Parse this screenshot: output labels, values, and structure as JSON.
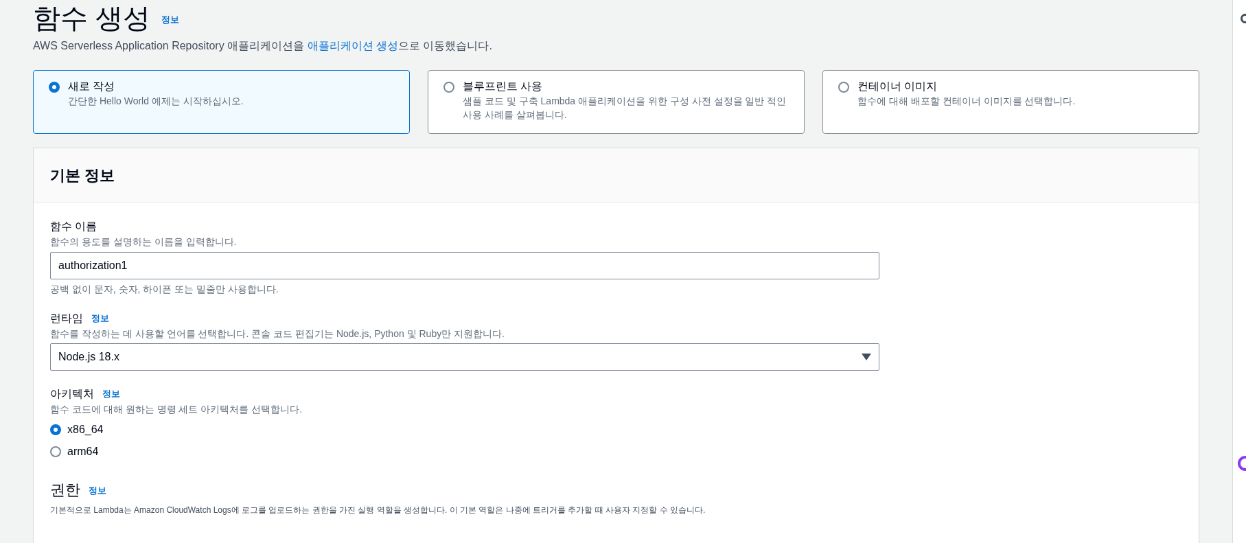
{
  "header": {
    "title": "함수 생성",
    "info_link": "정보",
    "notice_before": "AWS Serverless Application Repository 애플리케이션을 ",
    "notice_link": "애플리케이션 생성",
    "notice_after": "으로 이동했습니다."
  },
  "options": [
    {
      "title": "새로 작성",
      "description": "간단한 Hello World 예제는 시작하십시오.",
      "selected": true
    },
    {
      "title": "블루프린트 사용",
      "description": "샘플 코드 및 구축 Lambda 애플리케이션을 위한 구성 사전 설정을 일반 적인 사용 사례를 살펴봅니다.",
      "selected": false
    },
    {
      "title": "컨테이너 이미지",
      "description": "함수에 대해 배포할 컨테이너 이미지를 선택합니다.",
      "selected": false
    }
  ],
  "basic_info": {
    "title": "기본 정보",
    "function_name": {
      "label": "함수 이름",
      "description": "함수의 용도를 설명하는 이름을 입력합니다.",
      "value": "authorization1",
      "hint": "공백 없이 문자, 숫자, 하이픈 또는 밑줄만 사용합니다."
    },
    "runtime": {
      "label": "런타임",
      "info_link": "정보",
      "description": "함수를 작성하는 데 사용할 언어를 선택합니다. 콘솔 코드 편집기는 Node.js, Python 및 Ruby만 지원합니다.",
      "value": "Node.js 18.x"
    },
    "architecture": {
      "label": "아키텍처",
      "info_link": "정보",
      "description": "함수 코드에 대해 원하는 명령 세트 아키텍처를 선택합니다.",
      "choices": [
        {
          "label": "x86_64",
          "selected": true
        },
        {
          "label": "arm64",
          "selected": false
        }
      ]
    },
    "permissions": {
      "title": "권한",
      "info_link": "정보",
      "description": "기본적으로 Lambda는 Amazon CloudWatch Logs에 로그를 업로드하는 권한을 가진 실행 역할을 생성합니다. 이 기본 역할은 나중에 트리거를 추가할 때 사용자 지정할 수 있습니다."
    }
  }
}
